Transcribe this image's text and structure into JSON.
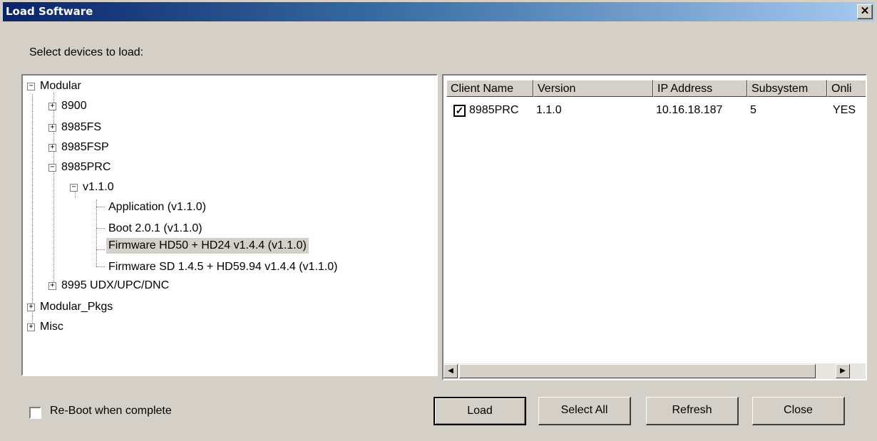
{
  "window": {
    "title": "Load Software",
    "close_glyph": "✕"
  },
  "select_label": "Select devices to load:",
  "tree": {
    "modular": "Modular",
    "n8900": "8900",
    "n8985fs": "8985FS",
    "n8985fsp": "8985FSP",
    "n8985prc": "8985PRC",
    "v110": "v1.1.0",
    "application": "Application (v1.1.0)",
    "boot": "Boot 2.0.1 (v1.1.0)",
    "firmware_hd": "Firmware HD50 + HD24 v1.4.4 (v1.1.0)",
    "firmware_sd": "Firmware SD 1.4.5 + HD59.94 v1.4.4 (v1.1.0)",
    "n8995": "8995 UDX/UPC/DNC",
    "modular_pkgs": "Modular_Pkgs",
    "misc": "Misc",
    "plus": "+",
    "minus": "−"
  },
  "grid": {
    "headers": [
      "Client Name",
      "Version",
      "IP Address",
      "Subsystem",
      "Onli"
    ],
    "rows": [
      {
        "checked": "✓",
        "client": "8985PRC",
        "version": "1.1.0",
        "ip": "10.16.18.187",
        "subsystem": "5",
        "online": "YES"
      }
    ],
    "scroll_left": "◀",
    "scroll_right": "▶"
  },
  "reboot_label": "Re-Boot when complete",
  "buttons": {
    "load": "Load",
    "select_all": "Select All",
    "refresh": "Refresh",
    "close": "Close"
  }
}
